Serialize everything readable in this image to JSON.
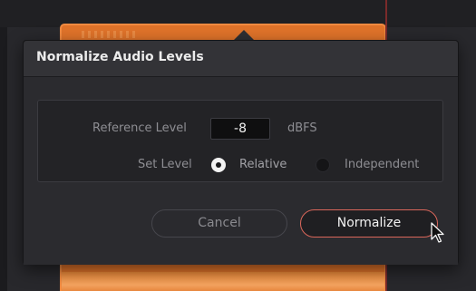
{
  "dialog": {
    "title": "Normalize Audio Levels",
    "reference_level_label": "Reference Level",
    "reference_level_value": "-8",
    "reference_level_unit": "dBFS",
    "set_level_label": "Set Level",
    "options": [
      {
        "label": "Relative",
        "selected": true
      },
      {
        "label": "Independent",
        "selected": false
      }
    ],
    "cancel_label": "Cancel",
    "normalize_label": "Normalize"
  },
  "icons": {
    "cursor": "mouse-pointer-icon"
  },
  "colors": {
    "clip_orange": "#e0732a",
    "normalize_border": "#d9665a",
    "playhead": "#7a2a2a"
  }
}
